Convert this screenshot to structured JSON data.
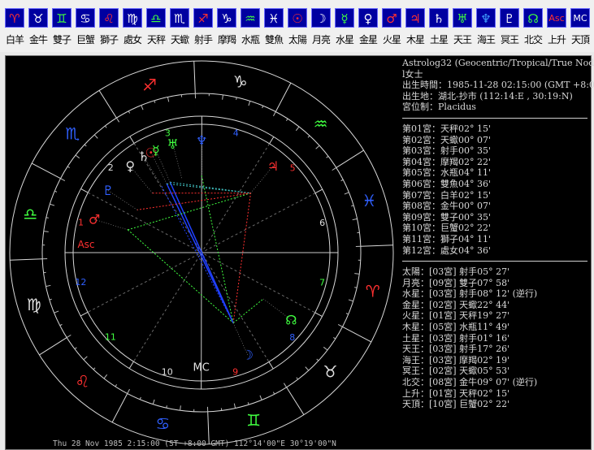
{
  "toolbar": [
    {
      "glyph": "♈",
      "label": "白羊",
      "name": "aries-icon",
      "color": "#ff3030"
    },
    {
      "glyph": "♉",
      "label": "金牛",
      "name": "taurus-icon",
      "color": "#ffffff"
    },
    {
      "glyph": "♊",
      "label": "雙子",
      "name": "gemini-icon",
      "color": "#40ff40"
    },
    {
      "glyph": "♋",
      "label": "巨蟹",
      "name": "cancer-icon",
      "color": "#ffffff"
    },
    {
      "glyph": "♌",
      "label": "獅子",
      "name": "leo-icon",
      "color": "#ff3030"
    },
    {
      "glyph": "♍",
      "label": "處女",
      "name": "virgo-icon",
      "color": "#ffffff"
    },
    {
      "glyph": "♎",
      "label": "天秤",
      "name": "libra-icon",
      "color": "#40ff40"
    },
    {
      "glyph": "♏",
      "label": "天蠍",
      "name": "scorpio-icon",
      "color": "#ffffff"
    },
    {
      "glyph": "♐",
      "label": "射手",
      "name": "sagittarius-icon",
      "color": "#ff3030"
    },
    {
      "glyph": "♑",
      "label": "摩羯",
      "name": "capricorn-icon",
      "color": "#ffffff"
    },
    {
      "glyph": "♒",
      "label": "水瓶",
      "name": "aquarius-icon",
      "color": "#40ff40"
    },
    {
      "glyph": "♓",
      "label": "雙魚",
      "name": "pisces-icon",
      "color": "#ffffff"
    },
    {
      "glyph": "☉",
      "label": "太陽",
      "name": "sun-icon",
      "color": "#ff3030"
    },
    {
      "glyph": "☽",
      "label": "月亮",
      "name": "moon-icon",
      "color": "#ffffff"
    },
    {
      "glyph": "☿",
      "label": "水星",
      "name": "mercury-icon",
      "color": "#40ff40"
    },
    {
      "glyph": "♀",
      "label": "金星",
      "name": "venus-icon",
      "color": "#ffffff"
    },
    {
      "glyph": "♂",
      "label": "火星",
      "name": "mars-icon",
      "color": "#ff3030"
    },
    {
      "glyph": "♃",
      "label": "木星",
      "name": "jupiter-icon",
      "color": "#ff3030"
    },
    {
      "glyph": "♄",
      "label": "土星",
      "name": "saturn-icon",
      "color": "#ffffff"
    },
    {
      "glyph": "♅",
      "label": "天王",
      "name": "uranus-icon",
      "color": "#40ff40"
    },
    {
      "glyph": "♆",
      "label": "海王",
      "name": "neptune-icon",
      "color": "#40a0ff"
    },
    {
      "glyph": "♇",
      "label": "冥王",
      "name": "pluto-icon",
      "color": "#ffffff"
    },
    {
      "glyph": "☊",
      "label": "北交",
      "name": "north-node-icon",
      "color": "#40ff40"
    },
    {
      "glyph": "Asc",
      "label": "上升",
      "name": "ascendant-icon",
      "color": "#ff3030"
    },
    {
      "glyph": "MC",
      "label": "天頂",
      "name": "midheaven-icon",
      "color": "#ffffff"
    }
  ],
  "header": [
    "Astrolog32 (Geocentric/Tropical/True Node)",
    "l女士",
    "出生時間：1985-11-28 02:15:00 (GMT +8:00)",
    "出生地：湖北-抄市 (112:14:E , 30:19:N)",
    "宮位制：Placidus"
  ],
  "houses": [
    "第01宮：天秤02°  15'",
    "第02宮：天蠍00°  07'",
    "第03宮：射手00°  35'",
    "第04宮：摩羯02°  22'",
    "第05宮：水瓶04°  11'",
    "第06宮：雙魚04°  36'",
    "第07宮：白羊02°  15'",
    "第08宮：金牛00°  07'",
    "第09宮：雙子00°  35'",
    "第10宮：巨蟹02°  22'",
    "第11宮：獅子04°  11'",
    "第12宮：處女04°  36'"
  ],
  "planets": [
    "太陽：[03宮] 射手05°  27'",
    "月亮：[09宮] 雙子07°  58'",
    "水星：[03宮] 射手08°  12' (逆行)",
    "金星：[02宮] 天蠍22°  44'",
    "火星：[01宮] 天秤19°  27'",
    "木星：[05宮] 水瓶11°  49'",
    "土星：[03宮] 射手01°  16'",
    "天王：[03宮] 射手17°  26'",
    "海王：[03宮] 摩羯02°  19'",
    "冥王：[02宮] 天蠍05°  53'",
    "北交：[08宮] 金牛09°  07' (逆行)",
    "上升：[01宮] 天秤02°  15'",
    "天頂：[10宮] 巨蟹02°  22'"
  ],
  "status": "Thu 28 Nov 1985  2:15:00 (ST +8:00 GMT) 112°14'00\"E 30°19'00\"N",
  "wheel": {
    "signs": [
      {
        "glyph": "♎",
        "color": "#40ff40",
        "name": "sign-libra"
      },
      {
        "glyph": "♏",
        "color": "#3060ff",
        "name": "sign-scorpio"
      },
      {
        "glyph": "♐",
        "color": "#ff3030",
        "name": "sign-sagittarius"
      },
      {
        "glyph": "♑",
        "color": "#e0e0e0",
        "name": "sign-capricorn"
      },
      {
        "glyph": "♒",
        "color": "#40ff40",
        "name": "sign-aquarius"
      },
      {
        "glyph": "♓",
        "color": "#3060ff",
        "name": "sign-pisces"
      },
      {
        "glyph": "♈",
        "color": "#ff3030",
        "name": "sign-aries"
      },
      {
        "glyph": "♉",
        "color": "#e0e0e0",
        "name": "sign-taurus"
      },
      {
        "glyph": "♊",
        "color": "#40ff40",
        "name": "sign-gemini"
      },
      {
        "glyph": "♋",
        "color": "#3060ff",
        "name": "sign-cancer"
      },
      {
        "glyph": "♌",
        "color": "#ff3030",
        "name": "sign-leo"
      },
      {
        "glyph": "♍",
        "color": "#e0e0e0",
        "name": "sign-virgo"
      }
    ],
    "house_numbers": [
      {
        "text": "1",
        "color": "#ff3030"
      },
      {
        "text": "2",
        "color": "#e0e0e0"
      },
      {
        "text": "3",
        "color": "#40ff40"
      },
      {
        "text": "4",
        "color": "#3060ff"
      },
      {
        "text": "5",
        "color": "#ff3030"
      },
      {
        "text": "6",
        "color": "#e0e0e0"
      },
      {
        "text": "7",
        "color": "#40ff40"
      },
      {
        "text": "8",
        "color": "#3060ff"
      },
      {
        "text": "9",
        "color": "#ff3030"
      },
      {
        "text": "10",
        "color": "#e0e0e0"
      },
      {
        "text": "11",
        "color": "#40ff40"
      },
      {
        "text": "12",
        "color": "#3060ff"
      }
    ],
    "cusps_deg": [
      182.25,
      210.12,
      240.58,
      272.37,
      304.18,
      334.6,
      2.25,
      30.12,
      60.58,
      92.37,
      124.18,
      154.6
    ],
    "planets": [
      {
        "glyph": "☉",
        "lon": 245.45,
        "color": "#ff3030",
        "name": "planet-sun"
      },
      {
        "glyph": "☽",
        "lon": 67.97,
        "color": "#3060ff",
        "name": "planet-moon"
      },
      {
        "glyph": "☿",
        "lon": 248.2,
        "color": "#40ff40",
        "name": "planet-mercury"
      },
      {
        "glyph": "♀",
        "lon": 232.73,
        "color": "#e0e0e0",
        "name": "planet-venus"
      },
      {
        "glyph": "♂",
        "lon": 199.45,
        "color": "#ff3030",
        "name": "planet-mars"
      },
      {
        "glyph": "♃",
        "lon": 311.82,
        "color": "#ff3030",
        "name": "planet-jupiter"
      },
      {
        "glyph": "♄",
        "lon": 241.27,
        "color": "#e0e0e0",
        "name": "planet-saturn"
      },
      {
        "glyph": "♅",
        "lon": 257.43,
        "color": "#40ff40",
        "name": "planet-uranus"
      },
      {
        "glyph": "♆",
        "lon": 272.32,
        "color": "#3060ff",
        "name": "planet-neptune"
      },
      {
        "glyph": "♇",
        "lon": 215.88,
        "color": "#3060ff",
        "name": "planet-pluto"
      },
      {
        "glyph": "☊",
        "lon": 39.12,
        "color": "#40ff40",
        "name": "planet-north-node"
      }
    ],
    "asc": {
      "glyph": "Asc",
      "lon": 182.25,
      "color": "#ff3030"
    },
    "mc": {
      "glyph": "MC",
      "lon": 92.37,
      "color": "#e0e0e0"
    }
  }
}
